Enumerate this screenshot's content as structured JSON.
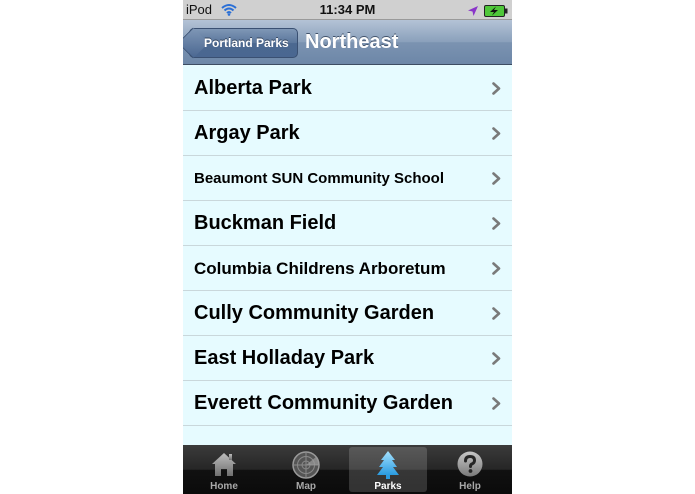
{
  "status_bar": {
    "carrier": "iPod",
    "time": "11:34 PM",
    "icons": [
      "wifi-icon",
      "location-arrow-icon",
      "battery-charging-icon"
    ]
  },
  "nav": {
    "back_label": "Portland Parks",
    "title": "Northeast"
  },
  "parks": [
    {
      "label": "Alberta Park",
      "size": "large"
    },
    {
      "label": "Argay Park",
      "size": "large"
    },
    {
      "label": "Beaumont SUN Community School",
      "size": "small"
    },
    {
      "label": "Buckman Field",
      "size": "large"
    },
    {
      "label": "Columbia Childrens Arboretum",
      "size": "medium"
    },
    {
      "label": "Cully Community Garden",
      "size": "large"
    },
    {
      "label": "East Holladay Park",
      "size": "large"
    },
    {
      "label": "Everett Community Garden",
      "size": "large"
    },
    {
      "label": "",
      "size": "large"
    }
  ],
  "tabs": [
    {
      "label": "Home",
      "icon": "home-icon",
      "selected": false
    },
    {
      "label": "Map",
      "icon": "radar-map-icon",
      "selected": false
    },
    {
      "label": "Parks",
      "icon": "tree-icon",
      "selected": true
    },
    {
      "label": "Help",
      "icon": "help-icon",
      "selected": false
    }
  ],
  "colors": {
    "list_background": "#e6fbff",
    "nav_bar": "#7b93b1",
    "tab_selected_icon": "#6ec6ff"
  }
}
